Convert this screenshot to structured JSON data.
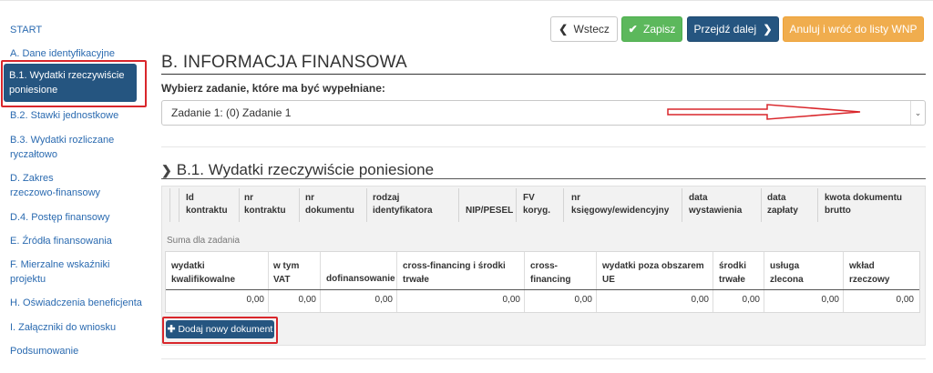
{
  "sidebar": {
    "items": [
      {
        "label": "START"
      },
      {
        "label": "A. Dane identyfikacyjne"
      },
      {
        "label": "B.1. Wydatki rzeczywiście poniesione"
      },
      {
        "label": "B.2. Stawki jednostkowe"
      },
      {
        "label": "B.3. Wydatki rozliczane ryczałtowo"
      },
      {
        "label": "D. Zakres rzeczowo-finansowy"
      },
      {
        "label": "D.4. Postęp finansowy"
      },
      {
        "label": "E. Źródła finansowania"
      },
      {
        "label": "F. Mierzalne wskaźniki projektu"
      },
      {
        "label": "H. Oświadczenia beneficjenta"
      },
      {
        "label": "I. Załączniki do wniosku"
      },
      {
        "label": "Podsumowanie"
      }
    ],
    "active_index": 2
  },
  "toolbar": {
    "back_label": "Wstecz",
    "save_label": "Zapisz",
    "next_label": "Przejdź dalej",
    "cancel_label": "Anuluj i wróć do listy WNP"
  },
  "page": {
    "title": "B. INFORMACJA FINANSOWA",
    "select_label": "Wybierz zadanie, które ma być wypełniane:",
    "select_value": "Zadanie 1: (0) Zadanie 1",
    "section_title": "B.1. Wydatki rzeczywiście poniesione"
  },
  "table": {
    "headers": [
      "Id kontraktu",
      "nr kontraktu",
      "nr dokumentu",
      "rodzaj identyfikatora",
      "NIP/PESEL",
      "FV koryg.",
      "nr księgowy/ewidencyjny",
      "data wystawienia",
      "data zapłaty",
      "kwota dokumentu brutto"
    ],
    "sum_label": "Suma dla zadania",
    "sum_headers": [
      "wydatki kwalifikowalne",
      "w tym VAT",
      "dofinansowanie",
      "cross-financing i środki trwałe",
      "cross-financing",
      "wydatki poza obszarem UE",
      "środki trwałe",
      "usługa zlecona",
      "wkład rzeczowy"
    ],
    "sum_values": [
      "0,00",
      "0,00",
      "0,00",
      "0,00",
      "0,00",
      "0,00",
      "0,00",
      "0,00",
      "0,00"
    ],
    "add_button_label": "Dodaj nowy dokument"
  },
  "colors": {
    "primary": "#255580",
    "success": "#5cb85c",
    "warning": "#f0ad4e",
    "annotation_red": "#d9262b"
  }
}
